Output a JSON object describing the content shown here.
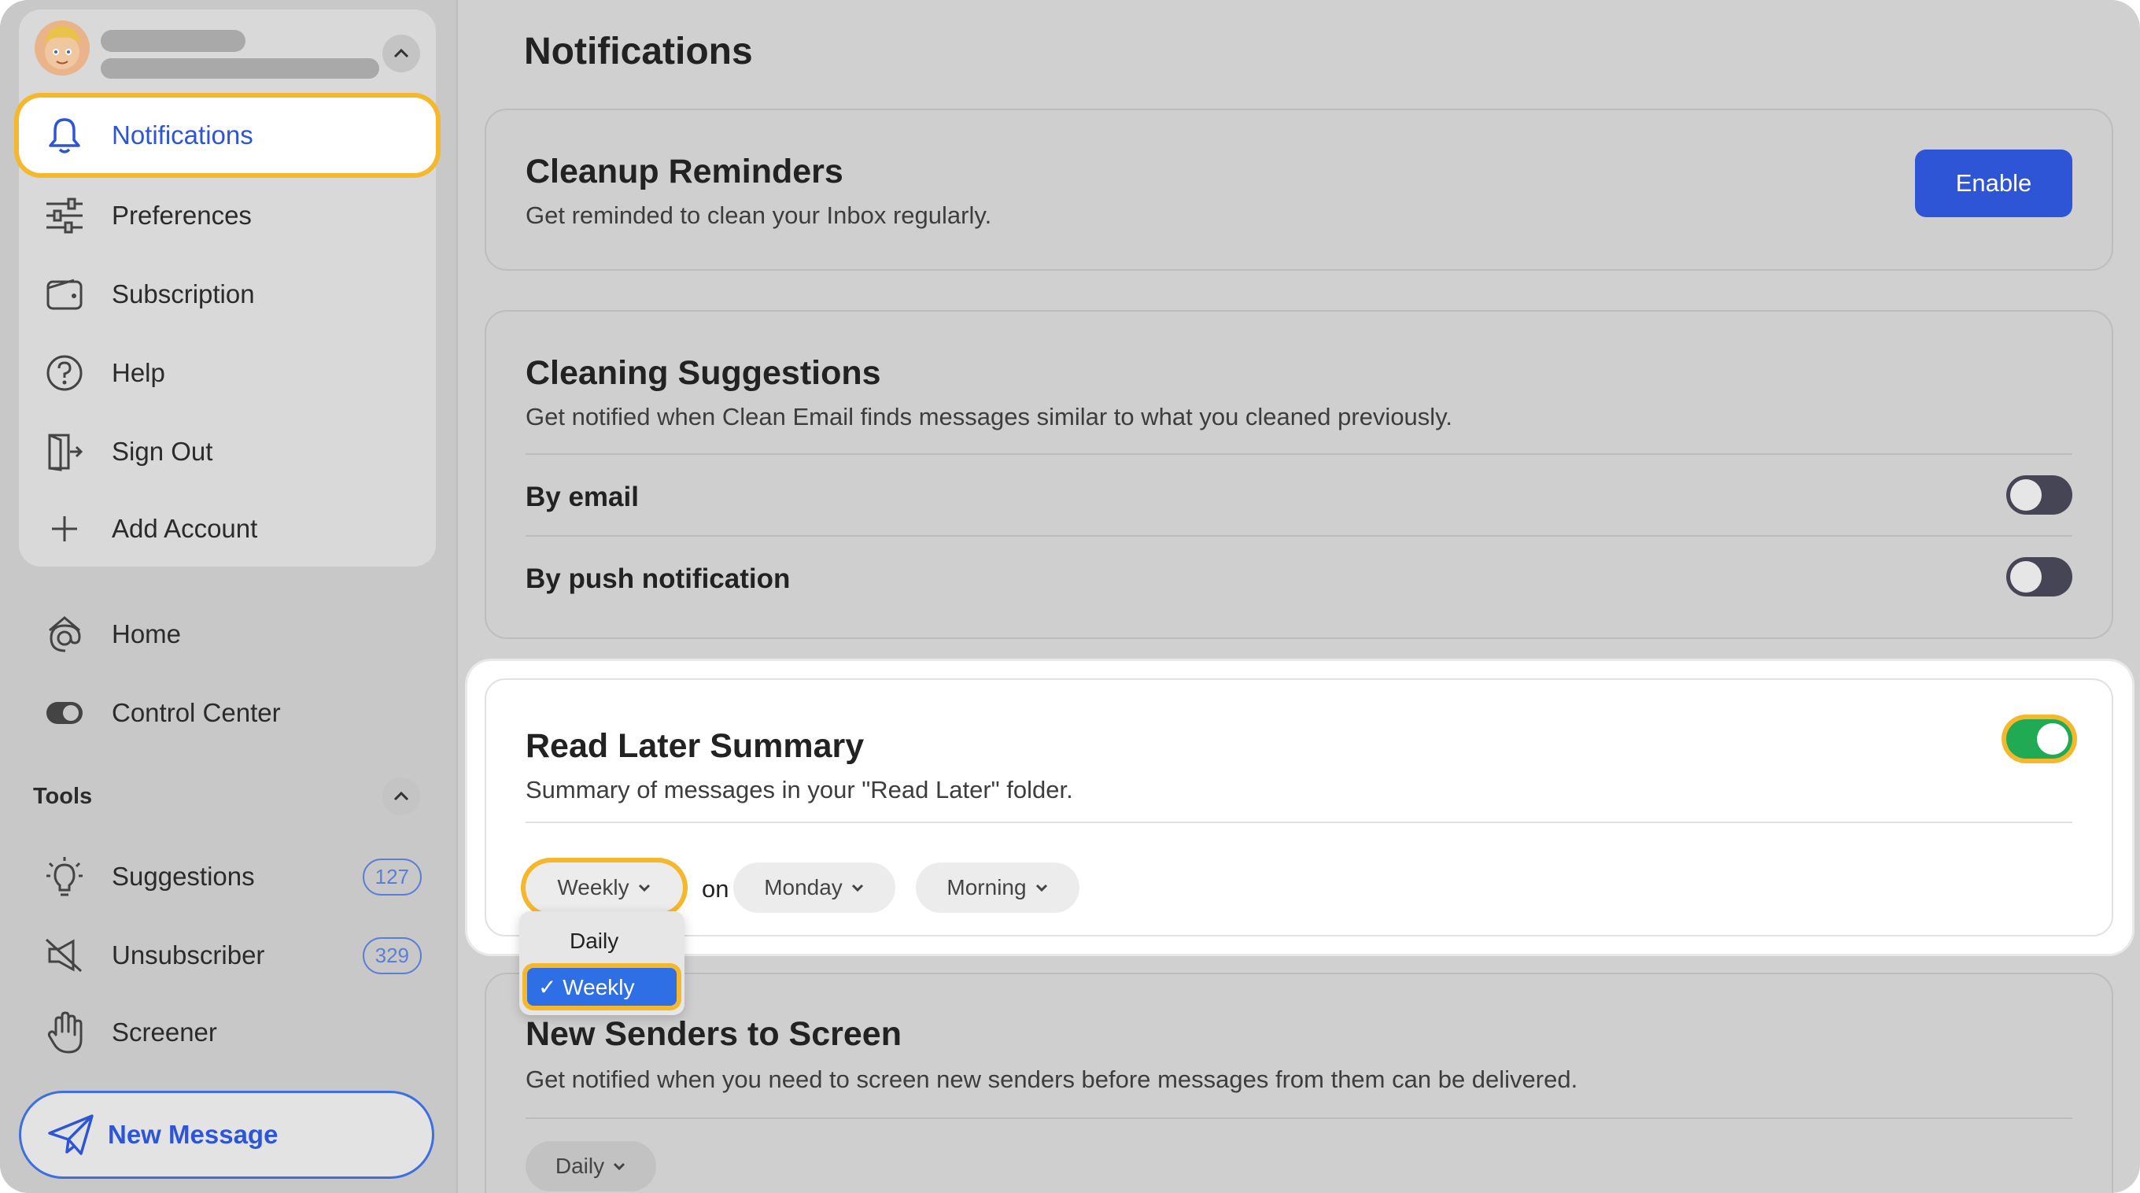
{
  "sidebar": {
    "items": [
      {
        "label": "Notifications",
        "icon": "bell-icon",
        "active": true
      },
      {
        "label": "Preferences",
        "icon": "sliders-icon"
      },
      {
        "label": "Subscription",
        "icon": "wallet-icon"
      },
      {
        "label": "Help",
        "icon": "question-icon"
      },
      {
        "label": "Sign Out",
        "icon": "sign-out-icon"
      },
      {
        "label": "Add Account",
        "icon": "plus-icon"
      }
    ],
    "nav": [
      {
        "label": "Home",
        "icon": "at-home-icon"
      },
      {
        "label": "Control Center",
        "icon": "toggle-icon"
      }
    ],
    "tools_label": "Tools",
    "tools": [
      {
        "label": "Suggestions",
        "icon": "lightbulb-icon",
        "badge": "127"
      },
      {
        "label": "Unsubscriber",
        "icon": "mute-icon",
        "badge": "329"
      },
      {
        "label": "Screener",
        "icon": "hand-icon"
      }
    ],
    "new_message": "New Message"
  },
  "main": {
    "title": "Notifications",
    "cleanup": {
      "title": "Cleanup Reminders",
      "desc": "Get reminded to clean your Inbox regularly.",
      "button": "Enable"
    },
    "cleaning": {
      "title": "Cleaning Suggestions",
      "desc": "Get notified when Clean Email finds messages similar to what you cleaned previously.",
      "by_email": "By email",
      "by_email_on": false,
      "by_push": "By push notification",
      "by_push_on": false
    },
    "read_later": {
      "title": "Read Later Summary",
      "desc": "Summary of messages in your \"Read Later\" folder.",
      "enabled": true,
      "frequency": "Weekly",
      "on": "on",
      "day": "Monday",
      "time": "Morning",
      "dropdown_options": [
        "Daily",
        "Weekly"
      ],
      "dropdown_selected": "✓ Weekly"
    },
    "new_senders": {
      "title": "New Senders to Screen",
      "desc": "Get notified when you need to screen new senders before messages from them can be delivered.",
      "frequency": "Daily"
    }
  },
  "colors": {
    "accent": "#2d55d6",
    "highlight": "#f5b72c",
    "toggle_on": "#1faa53",
    "toggle_off": "#454555"
  }
}
